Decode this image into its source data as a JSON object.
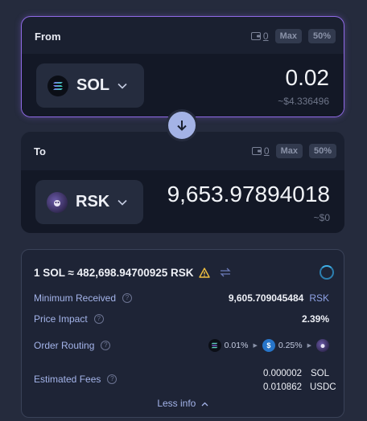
{
  "from": {
    "title": "From",
    "balance": "0",
    "max_label": "Max",
    "half_label": "50%",
    "token": {
      "symbol": "SOL",
      "icon": "solana-logo-icon"
    },
    "amount": "0.02",
    "usd_value": "~$4.336496"
  },
  "to": {
    "title": "To",
    "balance": "0",
    "max_label": "Max",
    "half_label": "50%",
    "token": {
      "symbol": "RSK",
      "icon": "rsk-logo-icon"
    },
    "amount": "9,653.97894018",
    "usd_value": "~$0"
  },
  "switch": {
    "icon": "arrow-down-icon"
  },
  "info": {
    "rate": "1 SOL ≈ 482,698.94700925 RSK",
    "minimum_received": {
      "label": "Minimum Received",
      "value": "9,605.709045484",
      "unit": "RSK"
    },
    "price_impact": {
      "label": "Price Impact",
      "value": "2.39%"
    },
    "order_routing": {
      "label": "Order Routing",
      "hops": [
        {
          "icon": "solana-logo-icon",
          "fee": "0.01%"
        },
        {
          "icon": "usdc-logo-icon",
          "fee": "0.25%"
        },
        {
          "icon": "rsk-logo-icon"
        }
      ]
    },
    "estimated_fees": {
      "label": "Estimated Fees",
      "items": [
        {
          "value": "0.000002",
          "unit": "SOL"
        },
        {
          "value": "0.010862",
          "unit": "USDC"
        }
      ]
    },
    "less_info": "Less info"
  },
  "colors": {
    "accent_border": "#8f6ae6",
    "switch_bg": "#a4b3e6",
    "label": "#a4b4ea",
    "warning": "#f0c040"
  }
}
